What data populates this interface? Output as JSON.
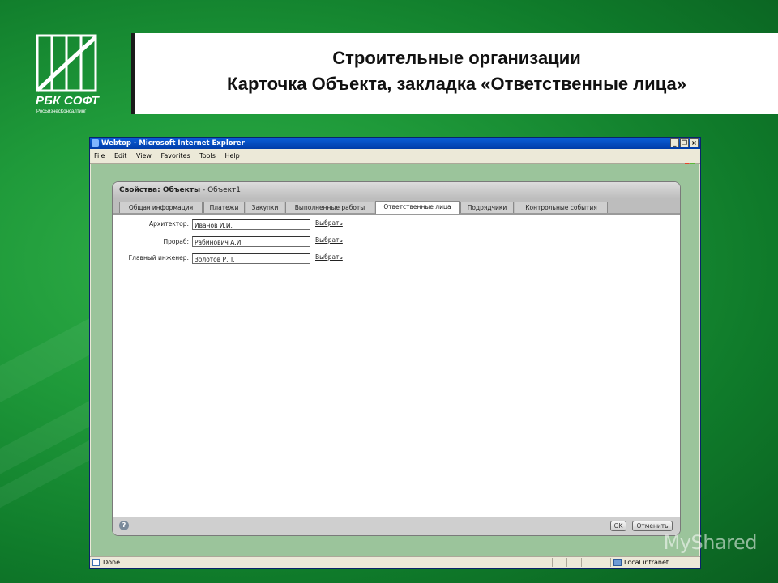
{
  "logo": {
    "name": "РБК СОФТ",
    "subtitle": "РосБизнесКонсалтинг"
  },
  "slide": {
    "title_line1": "Строительные организации",
    "title_line2": "Карточка Объекта, закладка «Ответственные лица»"
  },
  "browser": {
    "window_title": "Webtop - Microsoft Internet Explorer",
    "menu": [
      "File",
      "Edit",
      "View",
      "Favorites",
      "Tools",
      "Help"
    ],
    "status_text": "Done",
    "zone_text": "Local intranet"
  },
  "dialog": {
    "header_bold": "Свойства: Объекты",
    "header_rest": " - Объект1",
    "tabs": [
      {
        "label": "Общая информация"
      },
      {
        "label": "Платежи"
      },
      {
        "label": "Закупки"
      },
      {
        "label": "Выполненные работы"
      },
      {
        "label": "Ответственные лица"
      },
      {
        "label": "Подрядчики"
      },
      {
        "label": "Контрольные события"
      }
    ],
    "active_tab": "Ответственные лица",
    "fields": [
      {
        "label": "Архитектор:",
        "value": "Иванов И.И.",
        "action": "Выбрать"
      },
      {
        "label": "Прораб:",
        "value": "Рабинович А.И.",
        "action": "Выбрать"
      },
      {
        "label": "Главный инженер:",
        "value": "Золотов Р.П.",
        "action": "Выбрать"
      }
    ],
    "help_symbol": "?",
    "ok_label": "OK",
    "cancel_label": "Отменить"
  },
  "watermark": "MyShared",
  "colors": {
    "bg_green": "#1f9a3a",
    "ie_blue": "#0a5ed8"
  }
}
